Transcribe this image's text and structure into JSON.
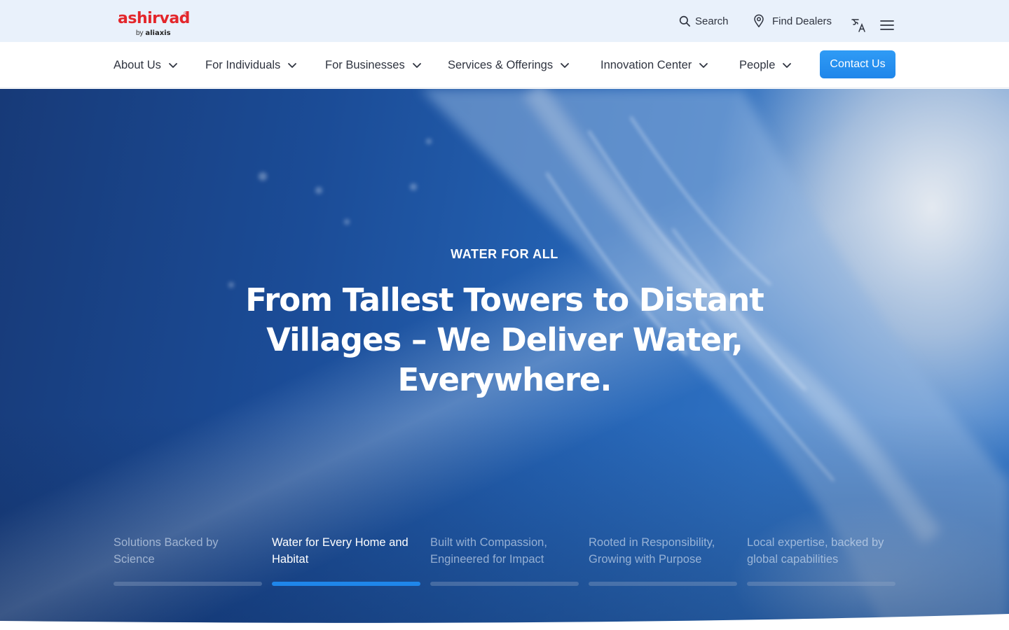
{
  "brand": {
    "name": "ashirvad",
    "registered": "®",
    "by": "by",
    "parent": "aliaxis"
  },
  "utility": {
    "search_label": "Search",
    "dealers_label": "Find Dealers",
    "language_icon": "translate-icon",
    "menu_icon": "hamburger-menu-icon"
  },
  "nav": {
    "items": [
      {
        "label": "About Us"
      },
      {
        "label": "For Individuals"
      },
      {
        "label": "For Businesses"
      },
      {
        "label": "Services & Offerings"
      },
      {
        "label": "Innovation Center"
      },
      {
        "label": "People"
      }
    ],
    "contact_label": "Contact Us"
  },
  "hero": {
    "eyebrow": "WATER FOR ALL",
    "headline": "From Tallest Towers to Distant Villages – We Deliver Water, Everywhere.",
    "slides": [
      {
        "label": "Solutions Backed by Science",
        "active": false
      },
      {
        "label": "Water for Every Home and Habitat",
        "active": true
      },
      {
        "label": "Built with Compassion, Engineered for Impact",
        "active": false
      },
      {
        "label": "Rooted in Responsibility, Growing with Purpose",
        "active": false
      },
      {
        "label": "Local expertise, backed by global capabilities",
        "active": false
      }
    ]
  },
  "colors": {
    "brand_red": "#e3262b",
    "accent_blue": "#1f86ea",
    "topbar_bg": "#e9f1fb"
  }
}
